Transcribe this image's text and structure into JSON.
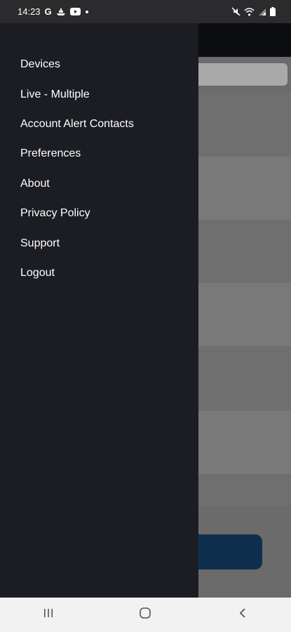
{
  "status_bar": {
    "time": "14:23",
    "left_icons": [
      "google-icon",
      "ship-icon",
      "youtube-icon",
      "dot-icon"
    ],
    "right_icons": [
      "mute-icon",
      "wifi-icon",
      "signal-icon",
      "battery-icon"
    ]
  },
  "drawer": {
    "items": [
      {
        "label": "Devices"
      },
      {
        "label": "Live - Multiple"
      },
      {
        "label": "Account Alert Contacts"
      },
      {
        "label": "Preferences"
      },
      {
        "label": "About"
      },
      {
        "label": "Privacy Policy"
      },
      {
        "label": "Support"
      },
      {
        "label": "Logout"
      }
    ]
  },
  "nav_bar": {
    "buttons": [
      "recent-apps-icon",
      "home-icon",
      "back-icon"
    ]
  },
  "colors": {
    "drawer_bg": "#1c1d23",
    "scrim": "#6b6b6b",
    "accent_button": "#0f2f4f",
    "nav_bar_bg": "#f2f2f2"
  }
}
